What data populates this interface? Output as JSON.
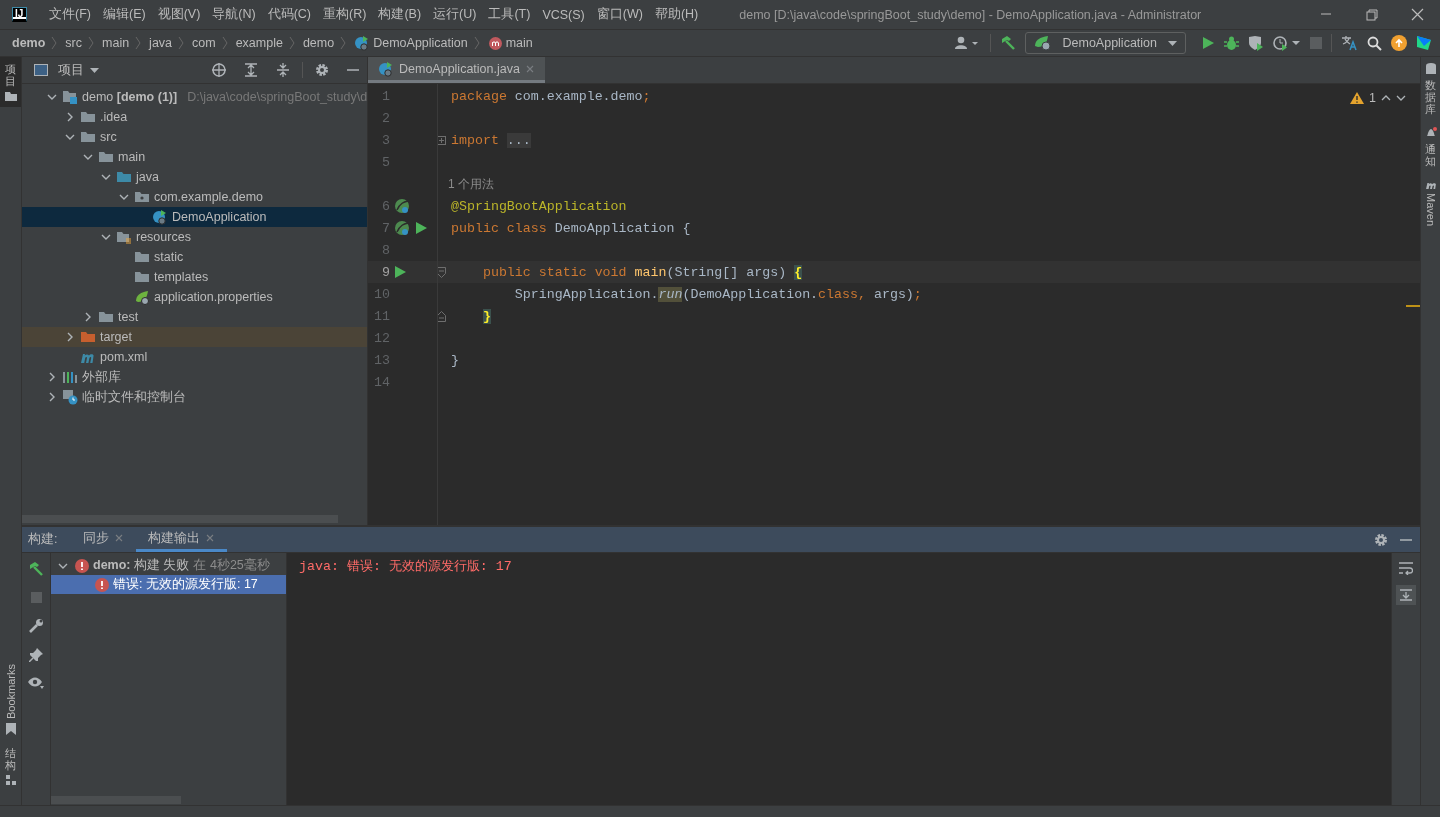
{
  "titlebar": {
    "logo": "IJ",
    "menu": [
      "文件(F)",
      "编辑(E)",
      "视图(V)",
      "导航(N)",
      "代码(C)",
      "重构(R)",
      "构建(B)",
      "运行(U)",
      "工具(T)",
      "VCS(S)",
      "窗口(W)",
      "帮助(H)"
    ],
    "title": "demo [D:\\java\\code\\springBoot_study\\demo] - DemoApplication.java - Administrator"
  },
  "navbar": {
    "breadcrumbs": [
      {
        "label": "demo",
        "kind": "project"
      },
      {
        "label": "src",
        "kind": "dir"
      },
      {
        "label": "main",
        "kind": "dir"
      },
      {
        "label": "java",
        "kind": "dir"
      },
      {
        "label": "com",
        "kind": "dir"
      },
      {
        "label": "example",
        "kind": "dir"
      },
      {
        "label": "demo",
        "kind": "dir"
      },
      {
        "label": "DemoApplication",
        "kind": "class"
      },
      {
        "label": "main",
        "kind": "method"
      }
    ],
    "run_config": "DemoApplication"
  },
  "left_strip": [
    {
      "label": "项目",
      "kind": "cjk",
      "selected": true
    },
    {
      "label": "Bookmarks",
      "kind": "latin",
      "selected": false
    },
    {
      "label": "结构",
      "kind": "cjk",
      "selected": false
    }
  ],
  "right_strip": [
    {
      "label": "数据库",
      "kind": "cjk"
    },
    {
      "label": "通知",
      "kind": "cjk"
    },
    {
      "label": "Maven",
      "kind": "latin"
    }
  ],
  "project": {
    "title": "项目",
    "tree": [
      {
        "label": "demo **[demo (1)]**",
        "path": "D:\\java\\code\\springBoot_study\\d",
        "kind": "module",
        "expanded": true,
        "selected": false,
        "children": [
          {
            "label": ".idea",
            "kind": "folder",
            "expanded": false,
            "selected": false
          },
          {
            "label": "src",
            "kind": "folder",
            "expanded": true,
            "selected": false,
            "children": [
              {
                "label": "main",
                "kind": "folder",
                "expanded": true,
                "selected": false,
                "children": [
                  {
                    "label": "java",
                    "kind": "source",
                    "expanded": true,
                    "selected": false,
                    "children": [
                      {
                        "label": "com.example.demo",
                        "kind": "package",
                        "expanded": true,
                        "selected": false,
                        "children": [
                          {
                            "label": "DemoApplication",
                            "kind": "class",
                            "selected": true
                          }
                        ]
                      }
                    ]
                  },
                  {
                    "label": "resources",
                    "kind": "resources",
                    "expanded": true,
                    "selected": false,
                    "children": [
                      {
                        "label": "static",
                        "kind": "folder",
                        "selected": false
                      },
                      {
                        "label": "templates",
                        "kind": "folder",
                        "selected": false
                      },
                      {
                        "label": "application.properties",
                        "kind": "config",
                        "selected": false
                      }
                    ]
                  }
                ]
              },
              {
                "label": "test",
                "kind": "folder",
                "expanded": false,
                "selected": false
              }
            ]
          },
          {
            "label": "target",
            "kind": "excluded",
            "expanded": false,
            "selected": false
          },
          {
            "label": "pom.xml",
            "kind": "maven",
            "selected": false
          }
        ]
      },
      {
        "label": "外部库",
        "kind": "library",
        "expanded": false,
        "selected": false
      },
      {
        "label": "临时文件和控制台",
        "kind": "scratch",
        "expanded": false,
        "selected": false
      }
    ]
  },
  "editor": {
    "tabs": [
      {
        "label": "DemoApplication.java",
        "selected": true
      }
    ],
    "warnings": "1",
    "lines": [
      {
        "kind": "code",
        "number": "1",
        "current": false,
        "tokens": [
          {
            "kind": "kw",
            "text": "package "
          },
          {
            "kind": "plain",
            "text": "com.example.demo"
          },
          {
            "kind": "kw",
            "text": ";"
          }
        ]
      },
      {
        "kind": "code",
        "number": "2",
        "current": false
      },
      {
        "kind": "fold",
        "number": "3",
        "current": false,
        "tokens": [
          {
            "kind": "kw",
            "text": "import "
          },
          {
            "kind": "folded",
            "text": "..."
          }
        ]
      },
      {
        "kind": "code",
        "number": "5",
        "current": false
      },
      {
        "kind": "hint",
        "text": "1 个用法"
      },
      {
        "kind": "bean",
        "number": "6",
        "current": false,
        "tokens": [
          {
            "kind": "ann",
            "text": "@SpringBootApplication"
          }
        ]
      },
      {
        "kind": "runnable-bean",
        "number": "7",
        "current": false,
        "tokens": [
          {
            "kind": "kw",
            "text": "public class "
          },
          {
            "kind": "plain",
            "text": "DemoApplication {"
          }
        ]
      },
      {
        "kind": "code",
        "number": "8",
        "current": false
      },
      {
        "kind": "runnable",
        "number": "9",
        "current": true,
        "tokens": [
          {
            "kind": "kw",
            "text": "    public static void "
          },
          {
            "kind": "fn",
            "text": "main"
          },
          {
            "kind": "plain",
            "text": "(String[] args) "
          },
          {
            "kind": "match",
            "text": "{"
          }
        ]
      },
      {
        "kind": "code",
        "number": "10",
        "current": false,
        "tokens": [
          {
            "kind": "plain",
            "text": "        SpringApplication."
          },
          {
            "kind": "italic",
            "text": "run"
          },
          {
            "kind": "plain",
            "text": "(DemoApplication."
          },
          {
            "kind": "kw",
            "text": "class, "
          },
          {
            "kind": "plain",
            "text": "args)"
          },
          {
            "kind": "kw",
            "text": ";"
          }
        ]
      },
      {
        "kind": "block-end",
        "number": "11",
        "current": false,
        "tokens": [
          {
            "kind": "match",
            "text": "    }"
          }
        ]
      },
      {
        "kind": "code",
        "number": "12",
        "current": false
      },
      {
        "kind": "code",
        "number": "13",
        "current": false,
        "tokens": [
          {
            "kind": "plain",
            "text": "}"
          }
        ]
      },
      {
        "kind": "code",
        "number": "14",
        "current": false
      }
    ]
  },
  "build": {
    "label": "构建:",
    "tabs": [
      {
        "label": "同步",
        "selected": false
      },
      {
        "label": "构建输出",
        "selected": true
      }
    ],
    "tree": [
      {
        "label": "**demo:** 构建 失败",
        "meta": "在 4秒25毫秒",
        "kind": "error",
        "expanded": true,
        "selected": false,
        "children": [
          {
            "label": "错误: 无效的源发行版: 17",
            "kind": "error",
            "selected": true
          }
        ]
      }
    ],
    "output": "java: 错误: 无效的源发行版: 17"
  }
}
